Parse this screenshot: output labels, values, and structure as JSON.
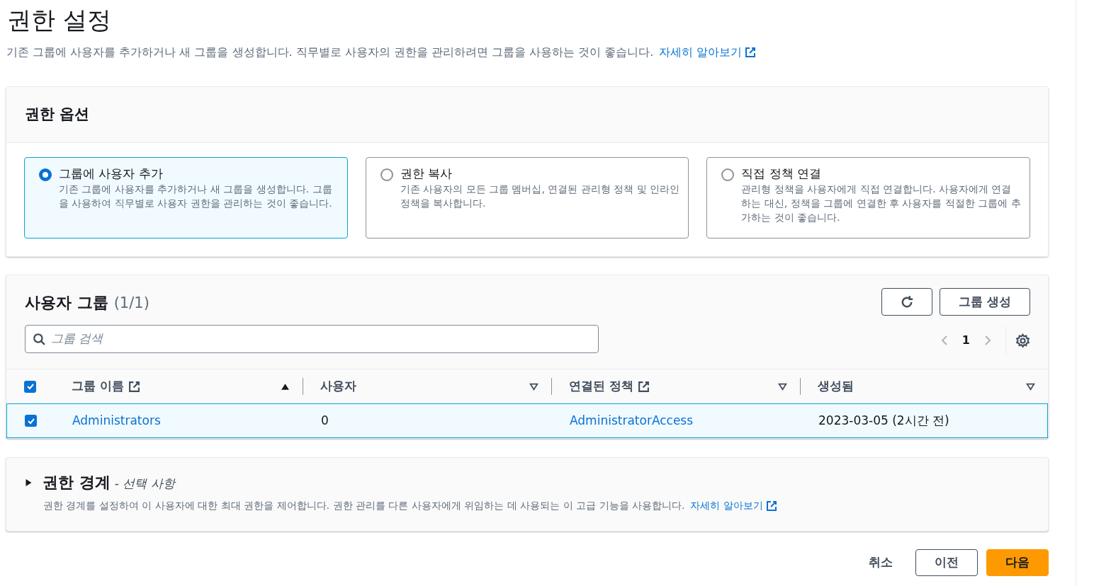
{
  "page": {
    "title": "권한 설정",
    "description": "기존 그룹에 사용자를 추가하거나 새 그룹을 생성합니다. 직무별로 사용자의 권한을 관리하려면 그룹을 사용하는 것이 좋습니다.",
    "learn_more": "자세히 알아보기"
  },
  "permission_options": {
    "title": "권한 옵션",
    "options": [
      {
        "label": "그룹에 사용자 추가",
        "description": "기존 그룹에 사용자를 추가하거나 새 그룹을 생성합니다. 그룹을 사용하여 직무별로 사용자 권한을 관리하는 것이 좋습니다.",
        "selected": true
      },
      {
        "label": "권한 복사",
        "description": "기존 사용자의 모든 그룹 멤버십, 연결된 관리형 정책 및 인라인 정책을 복사합니다.",
        "selected": false
      },
      {
        "label": "직접 정책 연결",
        "description": "관리형 정책을 사용자에게 직접 연결합니다. 사용자에게 연결하는 대신, 정책을 그룹에 연결한 후 사용자를 적절한 그룹에 추가하는 것이 좋습니다.",
        "selected": false
      }
    ]
  },
  "user_groups": {
    "title": "사용자 그룹",
    "count": "(1/1)",
    "create_button": "그룹 생성",
    "search": {
      "placeholder": "그룹 검색"
    },
    "pagination": {
      "page": "1"
    },
    "header_checked": true,
    "columns": [
      {
        "label": "그룹 이름",
        "external_link": true,
        "sorted": true
      },
      {
        "label": "사용자",
        "external_link": false,
        "sorted": false
      },
      {
        "label": "연결된 정책",
        "external_link": true,
        "sorted": false
      },
      {
        "label": "생성됨",
        "external_link": false,
        "sorted": false
      }
    ],
    "rows": [
      {
        "selected": true,
        "cells": [
          {
            "text": "Administrators",
            "kind": "link"
          },
          {
            "text": "0",
            "kind": "text"
          },
          {
            "text": "AdministratorAccess",
            "kind": "link"
          },
          {
            "text": "2023-03-05 (2시간 전)",
            "kind": "text"
          }
        ]
      }
    ]
  },
  "permissions_boundary": {
    "expanded": false,
    "title": "권한 경계",
    "subtitle": "- *선택 사항*",
    "description": "권한 경계를 설정하여 이 사용자에 대한 최대 권한을 제어합니다. 권한 관리를 다른 사용자에게 위임하는 데 사용되는 이 고급 기능을 사용합니다.",
    "learn_more": "자세히 알아보기"
  },
  "footer": {
    "buttons": [
      {
        "label": "취소",
        "kind": "link"
      },
      {
        "label": "이전",
        "kind": "secondary"
      },
      {
        "label": "다음",
        "kind": "primary"
      }
    ]
  }
}
